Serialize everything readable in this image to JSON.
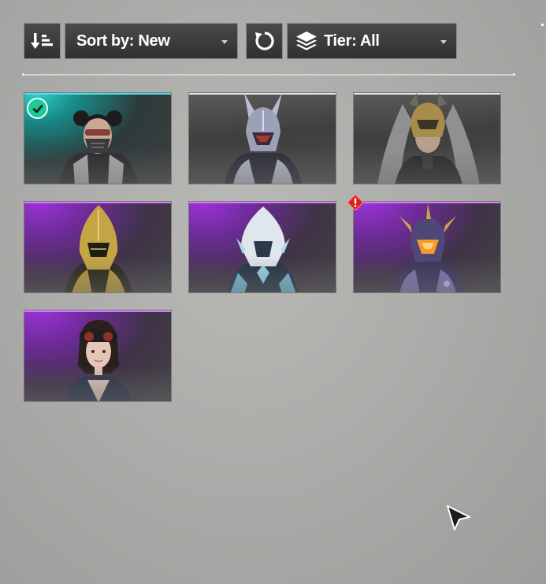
{
  "toolbar": {
    "sort_label": "Sort by: New",
    "tier_label": "Tier: All",
    "sort_order_icon": "sort-descending-icon",
    "reset_icon": "refresh-icon",
    "tier_icon": "layers-icon"
  },
  "colors": {
    "button_bg": "#3a3a3a",
    "teal_accent": "#4fe0f0",
    "purple_accent": "#d77af7",
    "grey_accent": "#e8e8e8",
    "equipped_badge": "#1fc79a",
    "alert_badge": "#e02020"
  },
  "cards": [
    {
      "name": "outfit-card-1",
      "rarity": "teal",
      "equipped": true,
      "alert": false
    },
    {
      "name": "outfit-card-2",
      "rarity": "grey",
      "equipped": false,
      "alert": false
    },
    {
      "name": "outfit-card-3",
      "rarity": "grey",
      "equipped": false,
      "alert": false
    },
    {
      "name": "outfit-card-4",
      "rarity": "purple",
      "equipped": false,
      "alert": false
    },
    {
      "name": "outfit-card-5",
      "rarity": "purple",
      "equipped": false,
      "alert": false
    },
    {
      "name": "outfit-card-6",
      "rarity": "purple",
      "equipped": false,
      "alert": true
    },
    {
      "name": "outfit-card-7",
      "rarity": "purple",
      "equipped": false,
      "alert": false
    }
  ]
}
